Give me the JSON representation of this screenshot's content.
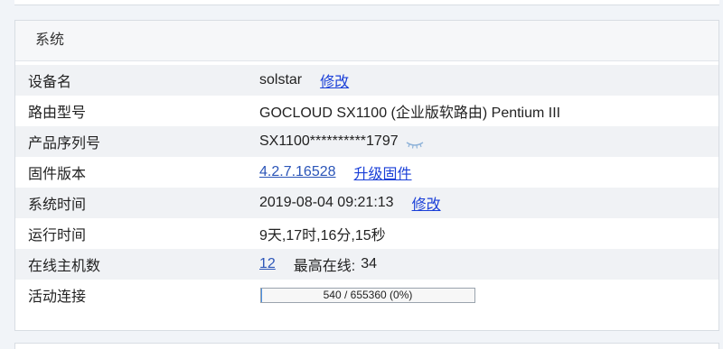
{
  "section": {
    "title": "系统"
  },
  "rows": {
    "device_name": {
      "label": "设备名",
      "value": "solstar",
      "action": "修改"
    },
    "router_model": {
      "label": "路由型号",
      "value": "GOCLOUD SX1100 (企业版软路由) Pentium III"
    },
    "serial": {
      "label": "产品序列号",
      "value": "SX1100**********1797",
      "icon": "eye-closed-icon"
    },
    "firmware": {
      "label": "固件版本",
      "version": "4.2.7.16528",
      "action": "升级固件"
    },
    "system_time": {
      "label": "系统时间",
      "value": "2019-08-04 09:21:13",
      "action": "修改"
    },
    "uptime": {
      "label": "运行时间",
      "value": "9天,17时,16分,15秒"
    },
    "online_hosts": {
      "label": "在线主机数",
      "count": "12",
      "max_label": "最高在线:",
      "max_value": "34"
    },
    "active_connections": {
      "label": "活动连接",
      "text": "540 / 655360 (0%)",
      "fraction": 0.0008
    }
  },
  "colors": {
    "link": "#1a3fd8",
    "alt_row": "#f0f2f5"
  }
}
